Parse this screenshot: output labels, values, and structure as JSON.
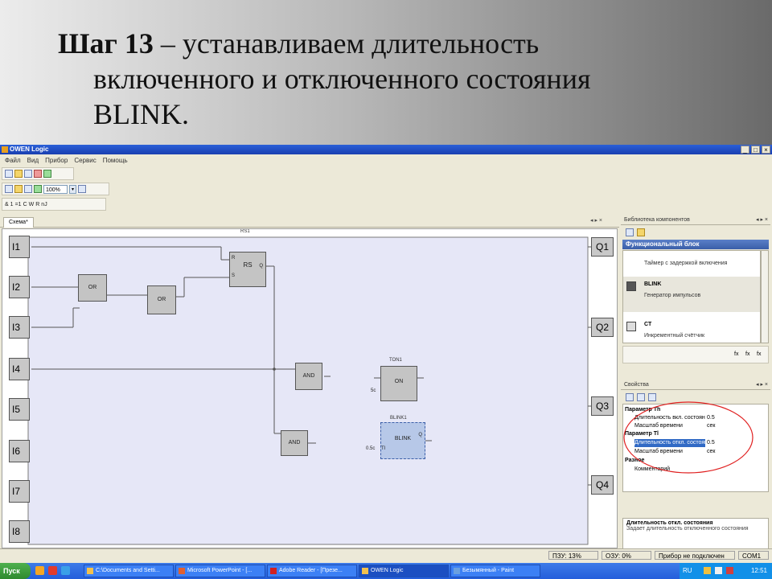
{
  "slide": {
    "title_bold": "Шаг 13",
    "title_line1": " – устанавливаем длительность",
    "title_line2": "включенного и отключенного состояния",
    "title_line3": "BLINK."
  },
  "window": {
    "title": "OWEN Logic",
    "buttons": [
      "_",
      "□",
      "×"
    ]
  },
  "menu": [
    "Файл",
    "Вид",
    "Прибор",
    "Сервис",
    "Помощь"
  ],
  "toolbar": {
    "zoom": "100%",
    "logic_labels": [
      "&",
      "1",
      "=1",
      "C",
      "W",
      "R",
      "nJ"
    ]
  },
  "doc_tab": {
    "label": "Схема*",
    "controls": "◂ ▸ ×"
  },
  "canvas": {
    "inputs": [
      "I1",
      "I2",
      "I3",
      "I4",
      "I5",
      "I6",
      "I7",
      "I8"
    ],
    "outputs": [
      "Q1",
      "Q2",
      "Q3",
      "Q4"
    ],
    "blocks": {
      "rs_caption": "RS1",
      "rs_label": "RS",
      "rs_pins": [
        "R",
        "S",
        "Q"
      ],
      "or1": "OR",
      "or2": "OR",
      "and1": "AND",
      "and2": "AND",
      "ton_caption": "TON1",
      "ton_label": "ON",
      "ton_pin": "5c",
      "blink_caption": "BLINK1",
      "blink_label": "BLINK",
      "blink_pins": [
        "Q",
        "0.5c",
        "Tl"
      ]
    }
  },
  "library": {
    "title": "Библиотека компонентов",
    "header": "Функциональный блок",
    "items": [
      {
        "name": "",
        "desc": "Таймер с задержкой включения"
      },
      {
        "name": "BLINK",
        "desc": "Генератор импульсов"
      },
      {
        "name": "CT",
        "desc": "Инкрементный счётчик"
      }
    ],
    "fx_buttons": [
      "fx",
      "fx",
      "fx"
    ]
  },
  "properties": {
    "title": "Свойства",
    "rows": [
      {
        "type": "cat",
        "label": "Параметр Th",
        "value": ""
      },
      {
        "type": "row",
        "label": "Длительность вкл. состояния",
        "value": "0.5"
      },
      {
        "type": "row",
        "label": "Масштаб времени",
        "value": "сек"
      },
      {
        "type": "cat",
        "label": "Параметр Tl",
        "value": ""
      },
      {
        "type": "row",
        "label": "Длительность откл. состояния",
        "value": "0.5",
        "highlight": true
      },
      {
        "type": "row",
        "label": "Масштаб времени",
        "value": "сек"
      },
      {
        "type": "cat",
        "label": "Разное",
        "value": ""
      },
      {
        "type": "row",
        "label": "Комментарий",
        "value": ""
      }
    ],
    "description_title": "Длительность откл. состояния",
    "description_text": "Задает длительность отключенного состояния",
    "annotation_color": "#e02020"
  },
  "status": {
    "pzu": "ПЗУ: 13%",
    "ozu": "ОЗУ: 0%",
    "device": "Прибор не подключен",
    "port": "COM1"
  },
  "taskbar": {
    "start": "Пуск",
    "tasks": [
      "C:\\Documents and Setti...",
      "Microsoft PowerPoint - [...",
      "Adobe Reader - [Презе...",
      "OWEN Logic",
      "Безымянный - Paint"
    ],
    "lang": "RU",
    "clock": "12:51"
  },
  "colors": {
    "canvas_bg": "#e6e7f7",
    "block_fill": "#c4c4c4",
    "selected_block": "#b7c8e8",
    "title_blue": "#2a5fd8"
  }
}
